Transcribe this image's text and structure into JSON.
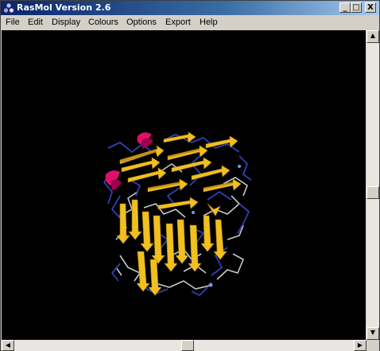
{
  "window": {
    "title": "RasMol Version 2.6",
    "controls": {
      "minimize": "_",
      "maximize": "□",
      "close": "X"
    }
  },
  "menu": {
    "items": [
      "File",
      "Edit",
      "Display",
      "Colours",
      "Options",
      "Export",
      "Help"
    ]
  },
  "viewer": {
    "background": "#000000",
    "colors": {
      "strand": "#f0c020",
      "strand_shade": "#b08010",
      "helix": "#e0106a",
      "coil_blue": "#3040b0",
      "coil_white": "#c8c8c8"
    }
  },
  "scrollbars": {
    "vertical": {
      "up_arrow": "▲",
      "down_arrow": "▼",
      "position_percent": 52
    },
    "horizontal": {
      "left_arrow": "◀",
      "right_arrow": "▶",
      "position_percent": 51
    }
  },
  "icons": {
    "app": "rasmol-molecule-icon"
  }
}
